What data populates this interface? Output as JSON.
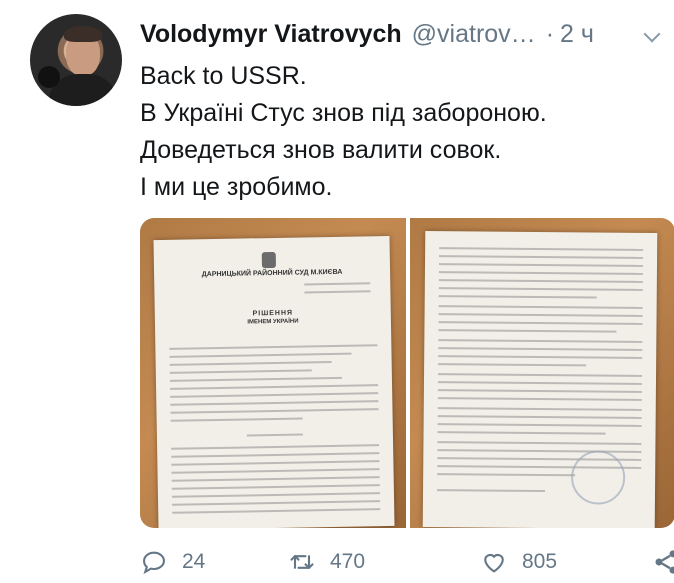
{
  "author": {
    "name": "Volodymyr Viatrovych",
    "handle": "@viatrov…",
    "separator": "·",
    "time": "2 ч"
  },
  "tweet": {
    "lines": [
      "Back to USSR.",
      "В Україні Стус знов під забороною.",
      "Доведеться знов валити совок.",
      "І ми це зробимо."
    ]
  },
  "media": {
    "photos": [
      {
        "court": "ДАРНИЦЬКИЙ РАЙОННИЙ СУД М.КИЄВА",
        "heading": "РІШЕННЯ",
        "subheading": "ІМЕНЕМ УКРАЇНИ"
      },
      {}
    ]
  },
  "stats": {
    "replies": "24",
    "retweets": "470",
    "likes": "805"
  },
  "icons": {
    "reply": "reply-icon",
    "retweet": "retweet-icon",
    "like": "heart-icon",
    "share": "share-icon"
  },
  "colors": {
    "text": "#14171a",
    "secondary": "#657786"
  }
}
